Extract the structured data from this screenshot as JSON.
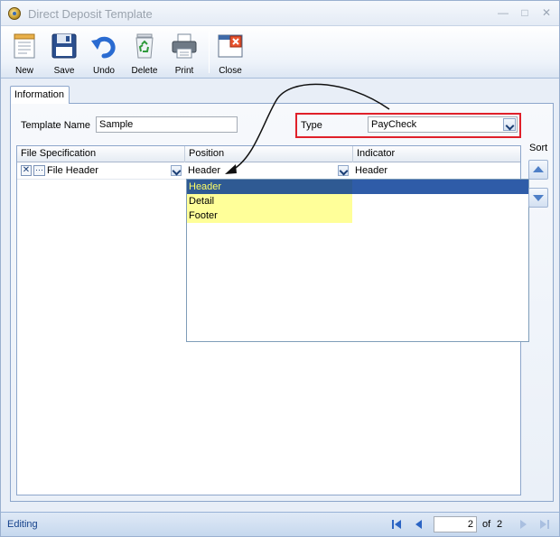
{
  "window": {
    "title": "Direct Deposit Template"
  },
  "toolbar": {
    "new_label": "New",
    "save_label": "Save",
    "undo_label": "Undo",
    "delete_label": "Delete",
    "print_label": "Print",
    "close_label": "Close"
  },
  "tabs": [
    {
      "label": "Information"
    }
  ],
  "form": {
    "template_name_label": "Template Name",
    "template_name_value": "Sample",
    "type_label": "Type",
    "type_value": "PayCheck"
  },
  "grid": {
    "columns": [
      "File Specification",
      "Position",
      "Indicator"
    ],
    "rows": [
      {
        "file_specification": "File Header",
        "position": "Header",
        "indicator": "Header"
      }
    ]
  },
  "position_dropdown": {
    "options": [
      "Header",
      "Detail",
      "Footer"
    ],
    "selected": "Header"
  },
  "sort": {
    "label": "Sort"
  },
  "status": {
    "text": "Editing",
    "page_current": "2",
    "page_of": "of",
    "page_total": "2"
  },
  "colors": {
    "accent": "#15428b",
    "highlight_border": "#e0202a",
    "dropdown_bg": "#ffff99",
    "selected_bg": "#2f5a93"
  }
}
